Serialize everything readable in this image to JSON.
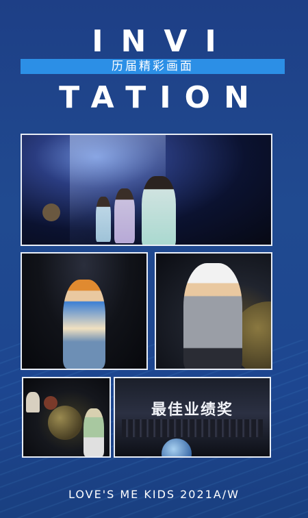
{
  "title_top": "INVI",
  "title_bottom": "TATION",
  "banner": "历届精彩画面",
  "award_text": "最佳业绩奖",
  "footer": "LOVE'S ME KIDS 2021A/W",
  "colors": {
    "background": "#1e3f86",
    "banner": "#2c8fe6",
    "frame": "#e9eef6"
  }
}
